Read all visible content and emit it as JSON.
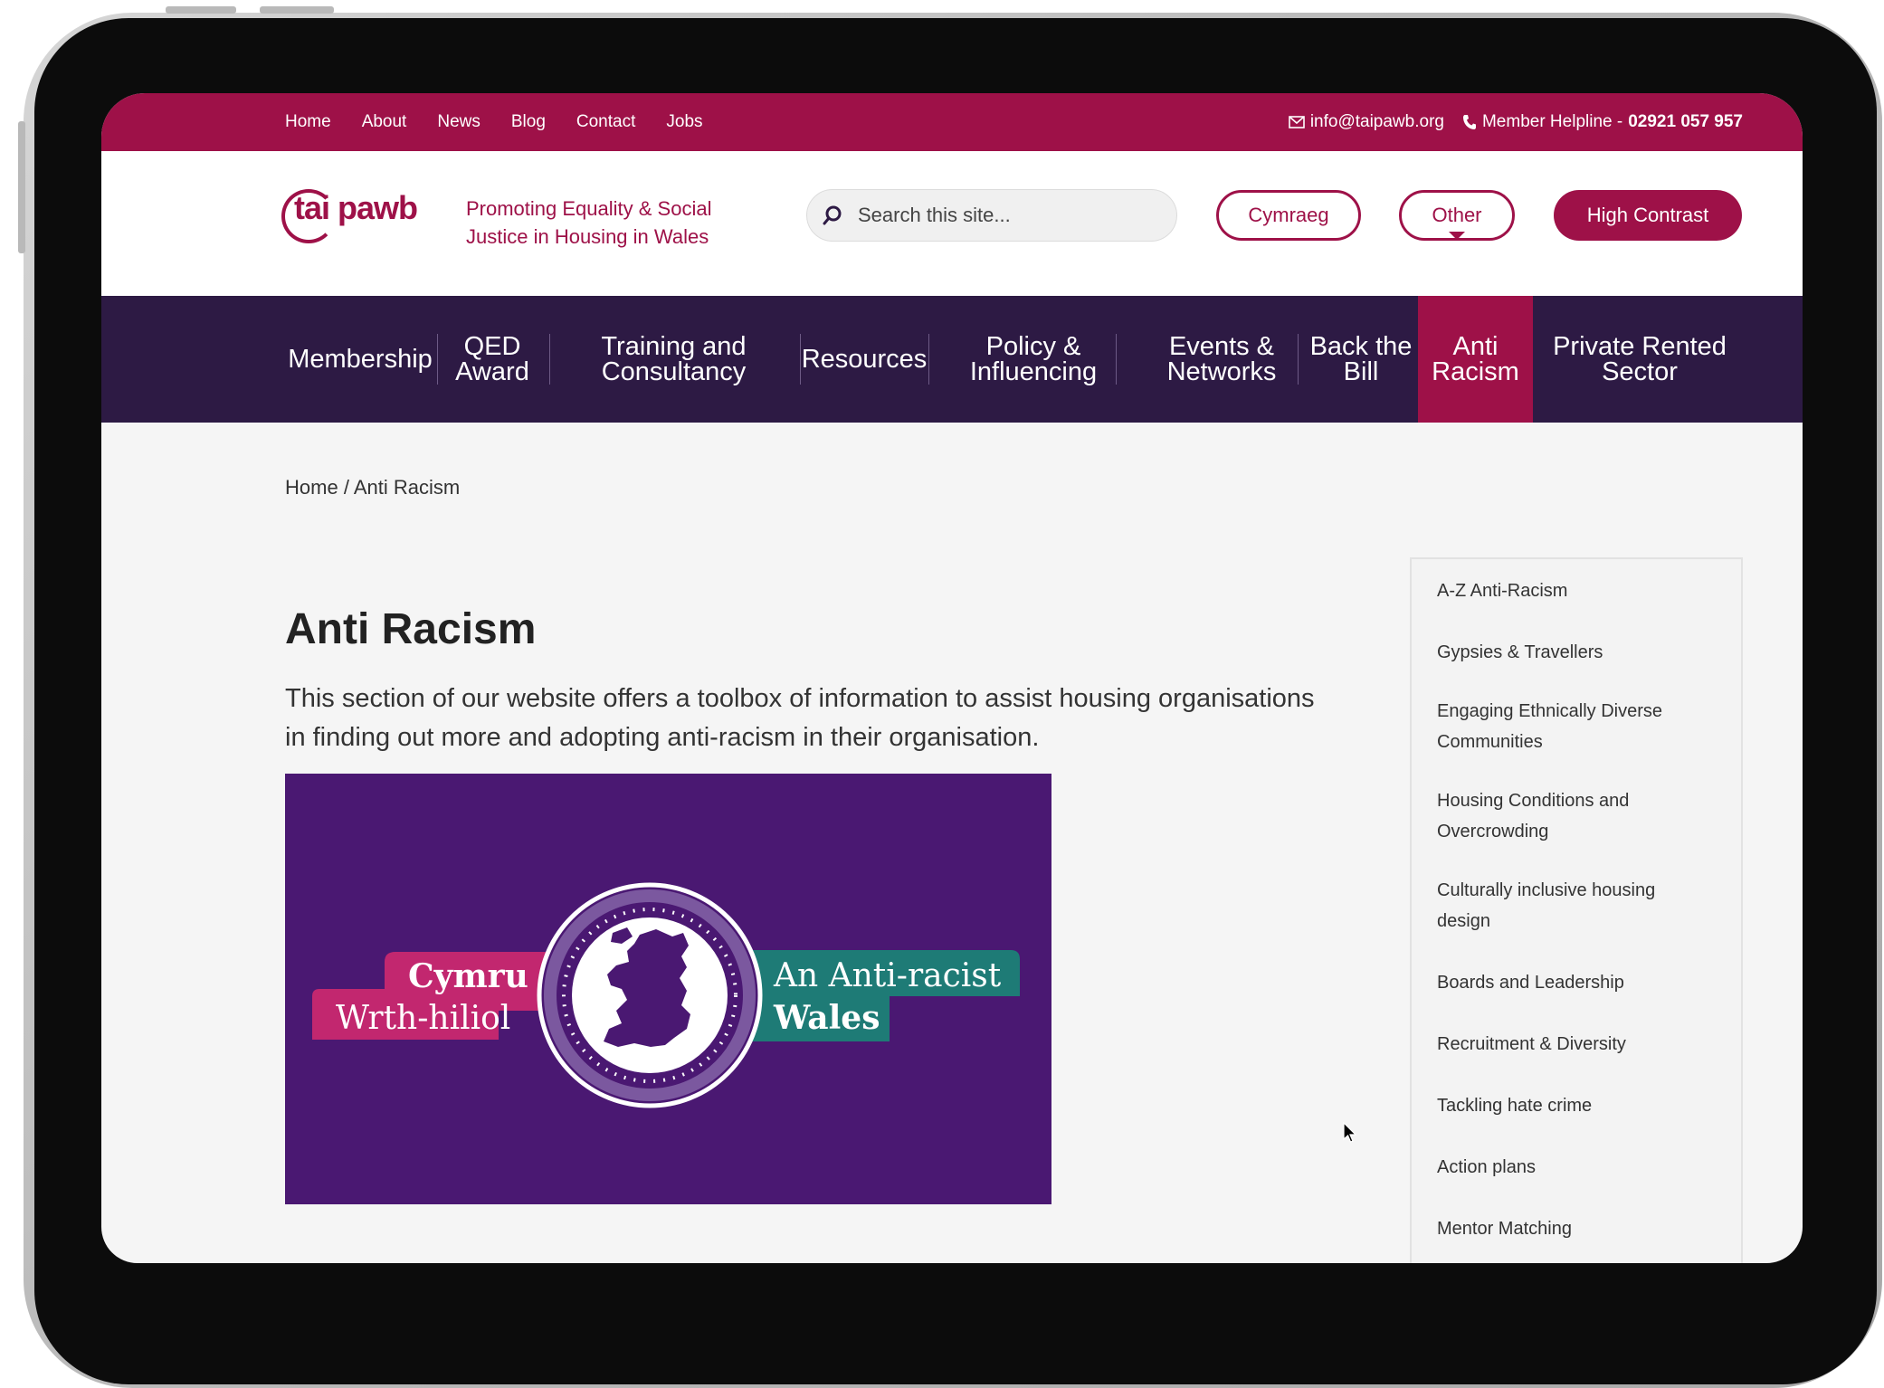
{
  "colors": {
    "brand": "#9e1148",
    "nav_bg": "#2d1a44",
    "banner_bg": "#4a1872",
    "banner_pink": "#c2276f",
    "banner_teal": "#1e7b76"
  },
  "topbar": {
    "links": [
      "Home",
      "About",
      "News",
      "Blog",
      "Contact",
      "Jobs"
    ],
    "email": "info@taipawb.org",
    "helpline_label": "Member Helpline -",
    "helpline_number": "02921 057 957"
  },
  "header": {
    "logo_text": "tai pawb",
    "tagline": "Promoting Equality & Social Justice in Housing in Wales",
    "search_placeholder": "Search this site...",
    "cymraeg_label": "Cymraeg",
    "other_label": "Other",
    "contrast_label": "High Contrast"
  },
  "nav": {
    "items": [
      "Membership",
      "QED Award",
      "Training and Consultancy",
      "Resources",
      "Policy & Influencing",
      "Events & Networks",
      "Back the Bill",
      "Anti Racism",
      "Private Rented Sector"
    ],
    "active": "Anti Racism"
  },
  "breadcrumb": {
    "home": "Home",
    "separator": "/",
    "current": "Anti Racism"
  },
  "main": {
    "title": "Anti Racism",
    "intro": "This section of our website offers a toolbox of information to assist housing organisations in finding out more and adopting anti-racism in their organisation."
  },
  "banner": {
    "welsh_line1": "Cymru",
    "welsh_line2": "Wrth-hiliol",
    "english_line1": "An Anti-racist",
    "english_line2": "Wales"
  },
  "sidebar": {
    "items": [
      "A-Z Anti-Racism",
      "Gypsies & Travellers",
      "Engaging Ethnically Diverse Communities",
      "Housing Conditions and Overcrowding",
      "Culturally inclusive housing design",
      "Boards and Leadership",
      "Recruitment & Diversity",
      "Tackling hate crime",
      "Action plans",
      "Mentor Matching"
    ]
  },
  "icons": {
    "email": "mail-icon",
    "phone": "phone-icon",
    "search": "search-icon",
    "pointer": "mouse-pointer-icon"
  }
}
